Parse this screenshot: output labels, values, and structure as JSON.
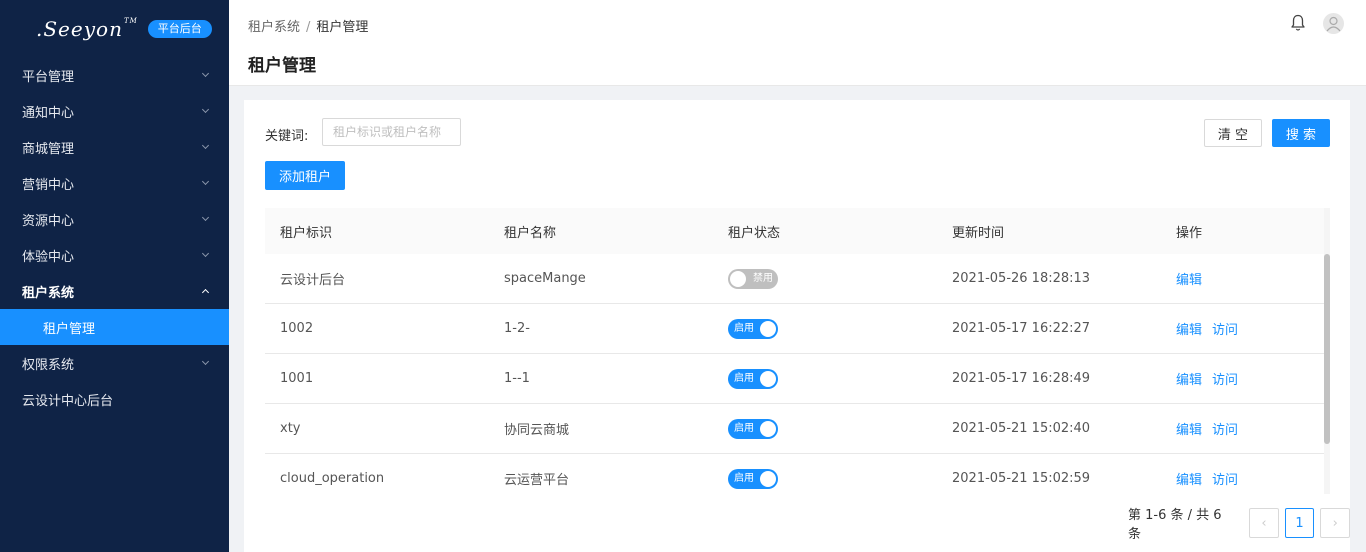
{
  "brand": {
    "logo": ".Seeyon",
    "tm": "TM",
    "badge": "平台后台"
  },
  "sidebar": {
    "items": [
      {
        "label": "平台管理"
      },
      {
        "label": "通知中心"
      },
      {
        "label": "商城管理"
      },
      {
        "label": "营销中心"
      },
      {
        "label": "资源中心"
      },
      {
        "label": "体验中心"
      },
      {
        "label": "租户系统",
        "open": true,
        "children": [
          {
            "label": "租户管理",
            "active": true
          }
        ]
      },
      {
        "label": "权限系统"
      },
      {
        "label": "云设计中心后台"
      }
    ]
  },
  "header": {
    "breadcrumb": [
      "租户系统",
      "租户管理"
    ],
    "breadcrumb_sep": "/",
    "title": "租户管理",
    "icons": [
      "bell-icon",
      "user-avatar-icon"
    ]
  },
  "search": {
    "label": "关键词:",
    "placeholder": "租户标识或租户名称",
    "value": "",
    "clear_label": "清 空",
    "search_label": "搜 索",
    "add_label": "添加租户"
  },
  "table": {
    "columns": [
      "租户标识",
      "租户名称",
      "租户状态",
      "更新时间",
      "操作"
    ],
    "rows": [
      {
        "id": "云设计后台",
        "name": "spaceMange",
        "status": "禁用",
        "enabled": false,
        "updated": "2021-05-26 18:28:13",
        "actions": [
          "编辑"
        ]
      },
      {
        "id": "1002",
        "name": "1-2-",
        "status": "启用",
        "enabled": true,
        "updated": "2021-05-17 16:22:27",
        "actions": [
          "编辑",
          "访问"
        ]
      },
      {
        "id": "1001",
        "name": "1--1",
        "status": "启用",
        "enabled": true,
        "updated": "2021-05-17 16:28:49",
        "actions": [
          "编辑",
          "访问"
        ]
      },
      {
        "id": "xty",
        "name": "协同云商城",
        "status": "启用",
        "enabled": true,
        "updated": "2021-05-21 15:02:40",
        "actions": [
          "编辑",
          "访问"
        ]
      },
      {
        "id": "cloud_operation",
        "name": "云运营平台",
        "status": "启用",
        "enabled": true,
        "updated": "2021-05-21 15:02:59",
        "actions": [
          "编辑",
          "访问"
        ]
      }
    ]
  },
  "pagination": {
    "summary": "第 1-6 条 / 共 6 条",
    "current_page": "1",
    "prev": "‹",
    "next": "›"
  },
  "colors": {
    "sidebar_bg": "#0f2346",
    "accent": "#1890ff",
    "switch_off": "#bfbfbf"
  }
}
